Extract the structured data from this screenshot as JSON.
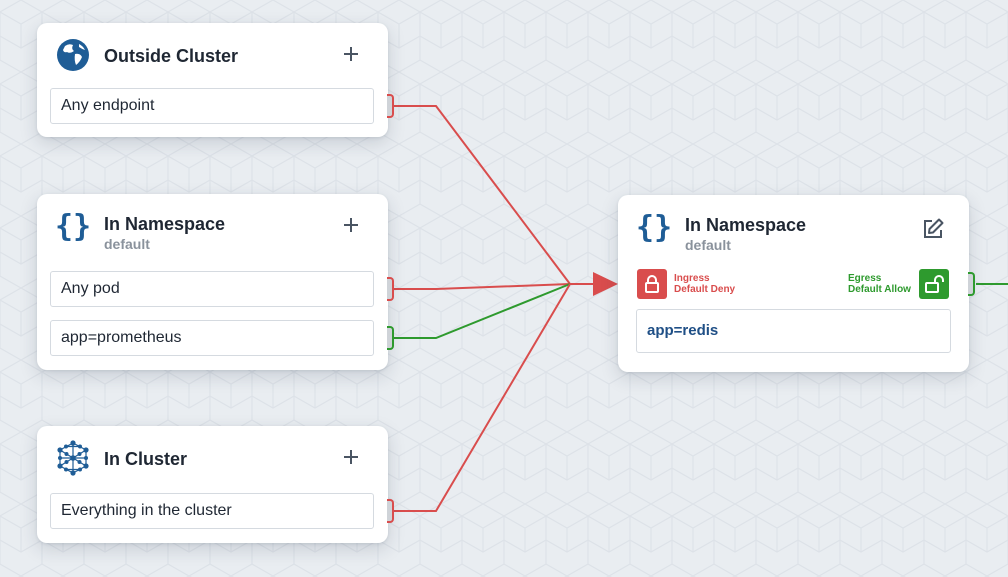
{
  "colors": {
    "deny": "#d94d4d",
    "allow": "#2e9a2e",
    "icon_blue": "#1f5d96",
    "label_blue": "#1f4f86",
    "muted": "#8a929c"
  },
  "source_cards": [
    {
      "title": "Outside Cluster",
      "icon": "globe-icon",
      "selectors": [
        "Any endpoint"
      ]
    },
    {
      "title": "In Namespace",
      "subtitle": "default",
      "icon": "braces-icon",
      "selectors": [
        "Any pod",
        "app=prometheus"
      ]
    },
    {
      "title": "In Cluster",
      "icon": "cluster-network-icon",
      "selectors": [
        "Everything in the cluster"
      ]
    }
  ],
  "target_card": {
    "title": "In Namespace",
    "subtitle": "default",
    "icon": "braces-icon",
    "ingress": {
      "line1": "Ingress",
      "line2": "Default Deny",
      "icon": "lock-closed-icon"
    },
    "egress": {
      "line1": "Egress",
      "line2": "Default Allow",
      "icon": "lock-open-icon"
    },
    "selector": "app=redis"
  },
  "connections": [
    {
      "from": "Any endpoint",
      "status": "deny"
    },
    {
      "from": "Any pod",
      "status": "deny"
    },
    {
      "from": "app=prometheus",
      "status": "allow"
    },
    {
      "from": "Everything in the cluster",
      "status": "deny"
    },
    {
      "from": "egress",
      "status": "allow"
    }
  ]
}
